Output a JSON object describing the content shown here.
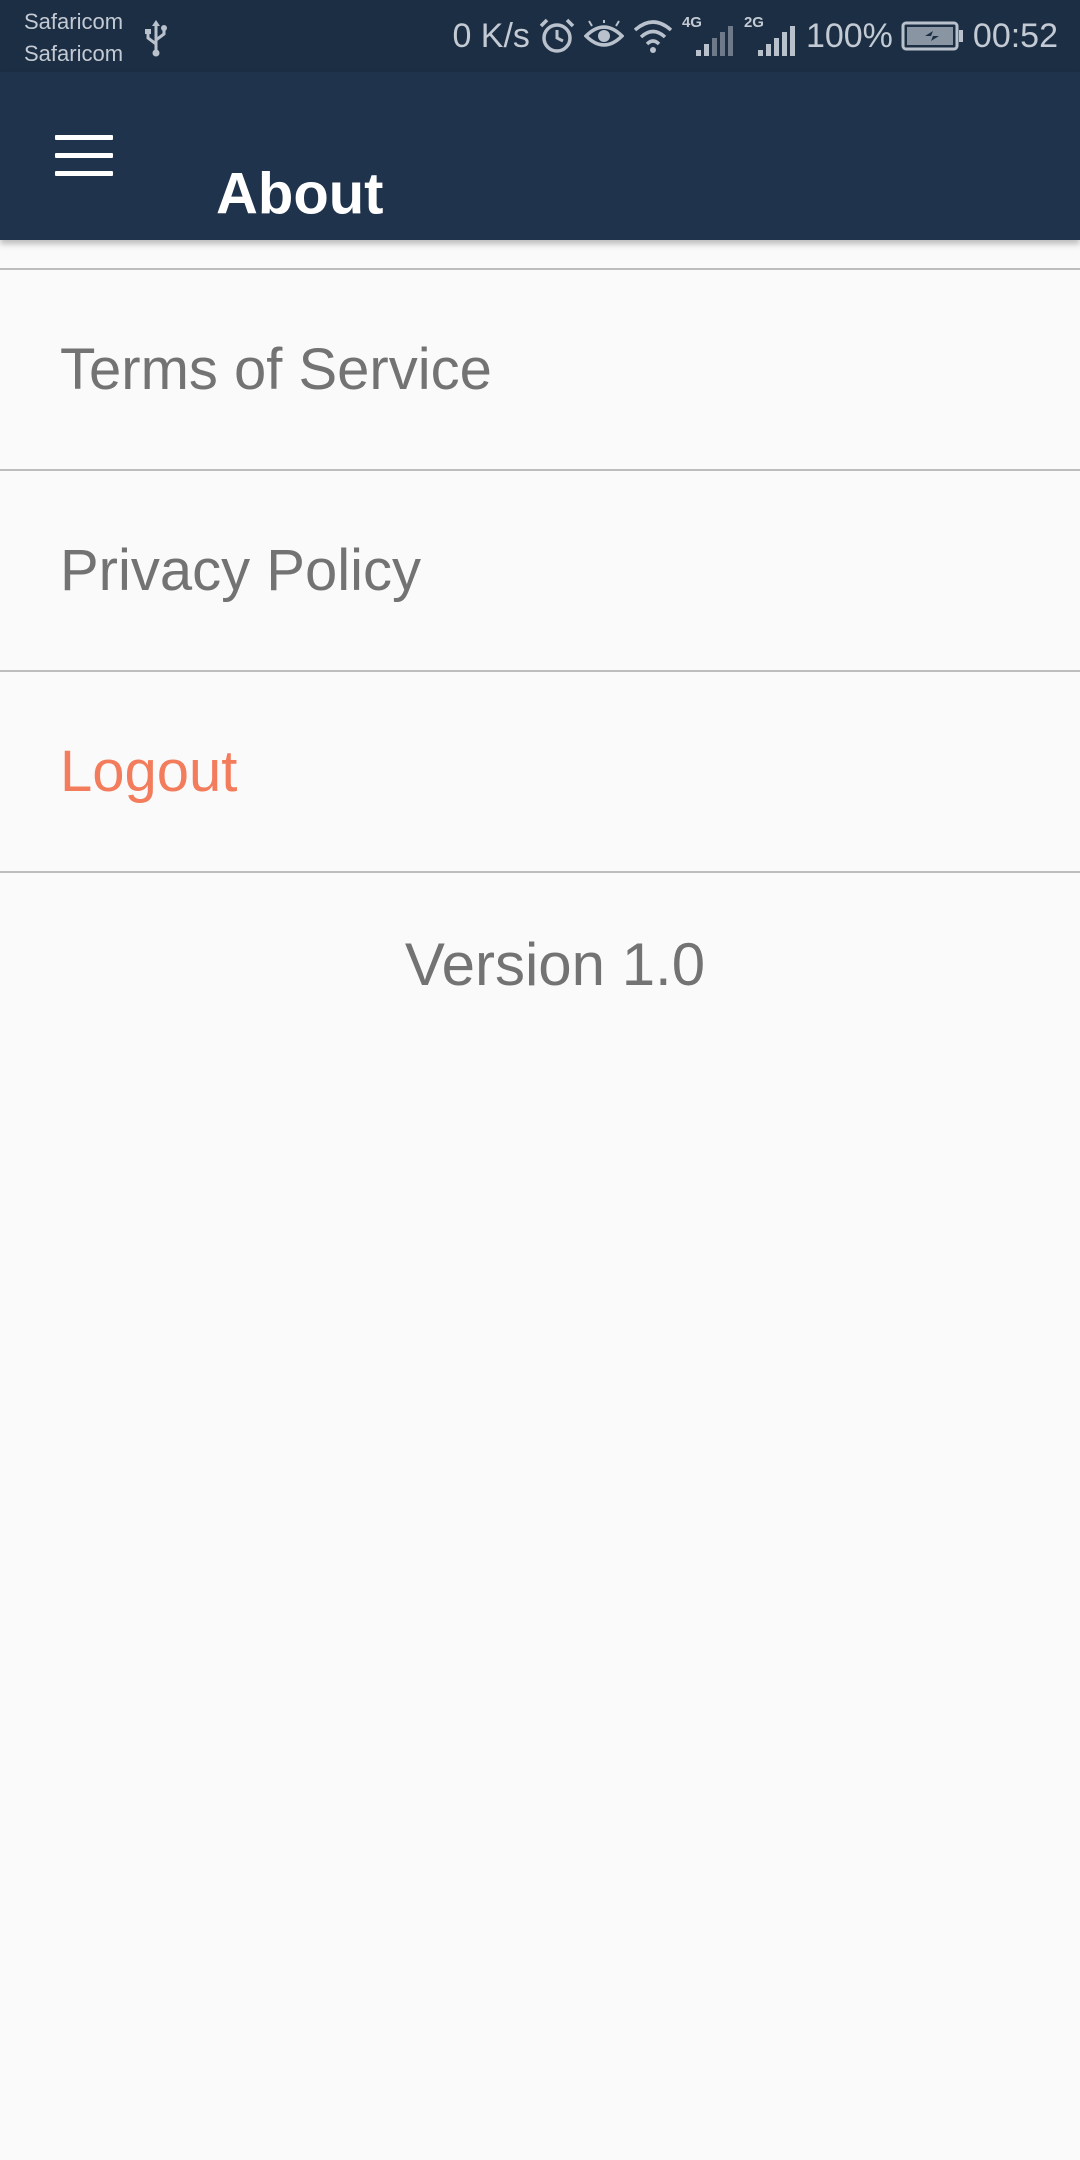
{
  "status_bar": {
    "carrier_1": "Safaricom",
    "carrier_2": "Safaricom",
    "net_speed": "0 K/s",
    "net_type_1": "4G",
    "net_type_2": "2G",
    "battery": "100%",
    "time": "00:52",
    "icons": [
      "usb-icon",
      "alarm-icon",
      "eye-icon",
      "wifi-icon",
      "signal-icon",
      "signal-icon",
      "battery-charging-icon"
    ]
  },
  "app_bar": {
    "menu_icon": "hamburger-menu-icon",
    "title": "About",
    "background": "#1f334d"
  },
  "menu": {
    "items": [
      {
        "label": "Terms of Service"
      },
      {
        "label": "Privacy Policy"
      },
      {
        "label": "Logout",
        "color": "#f27c5c"
      }
    ]
  },
  "footer": {
    "version": "Version 1.0"
  }
}
